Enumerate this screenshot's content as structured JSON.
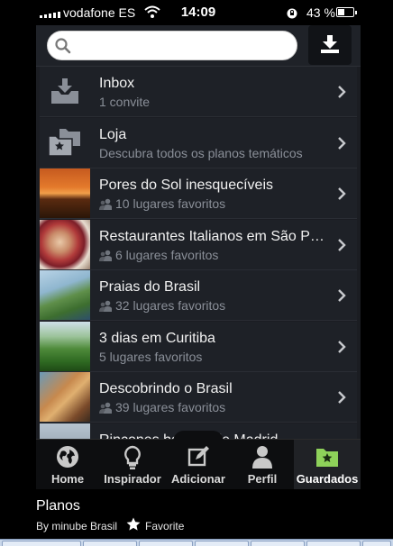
{
  "status_bar": {
    "carrier": "vodafone ES",
    "time": "14:09",
    "battery": "43 %",
    "battery_level": 0.43
  },
  "search": {
    "placeholder": "",
    "value": ""
  },
  "list_items": [
    {
      "title": "Inbox",
      "subtitle": "1 convite",
      "icon": "inbox-tray-icon",
      "show_people_icon": false
    },
    {
      "title": "Loja",
      "subtitle": "Descubra todos os planos temáticos",
      "icon": "folders-star-icon",
      "show_people_icon": false
    },
    {
      "title": "Pores do Sol inesquecíveis",
      "subtitle": "10 lugares favoritos",
      "icon": "sunset-photo",
      "show_people_icon": true
    },
    {
      "title": "Restaurantes Italianos em São Paulo",
      "subtitle": "6 lugares favoritos",
      "icon": "food-photo",
      "show_people_icon": true
    },
    {
      "title": "Praias do Brasil",
      "subtitle": "32 lugares favoritos",
      "icon": "beach-photo",
      "show_people_icon": true
    },
    {
      "title": "3 dias em Curitiba",
      "subtitle": "5 lugares favoritos",
      "icon": "forest-photo",
      "show_people_icon": false
    },
    {
      "title": "Descobrindo o Brasil",
      "subtitle": "39 lugares favoritos",
      "icon": "hammock-photo",
      "show_people_icon": true
    },
    {
      "title": "Rincones bonitos de Madrid",
      "subtitle": "",
      "icon": "city-photo",
      "show_people_icon": false
    }
  ],
  "tabs": [
    {
      "label": "Home",
      "icon": "globe-icon"
    },
    {
      "label": "Inspirador",
      "icon": "lightbulb-icon"
    },
    {
      "label": "Adicionar",
      "icon": "edit-icon"
    },
    {
      "label": "Perfil",
      "icon": "person-icon"
    },
    {
      "label": "Guardados",
      "icon": "folder-star-icon",
      "active": true
    }
  ],
  "caption": {
    "title": "Planos",
    "author": "By minube Brasil",
    "favorite_label": "Favorite"
  },
  "colors": {
    "accent_green": "#8ed15a",
    "list_background": "#1e2127",
    "subtitle_gray": "#8a8f98"
  }
}
